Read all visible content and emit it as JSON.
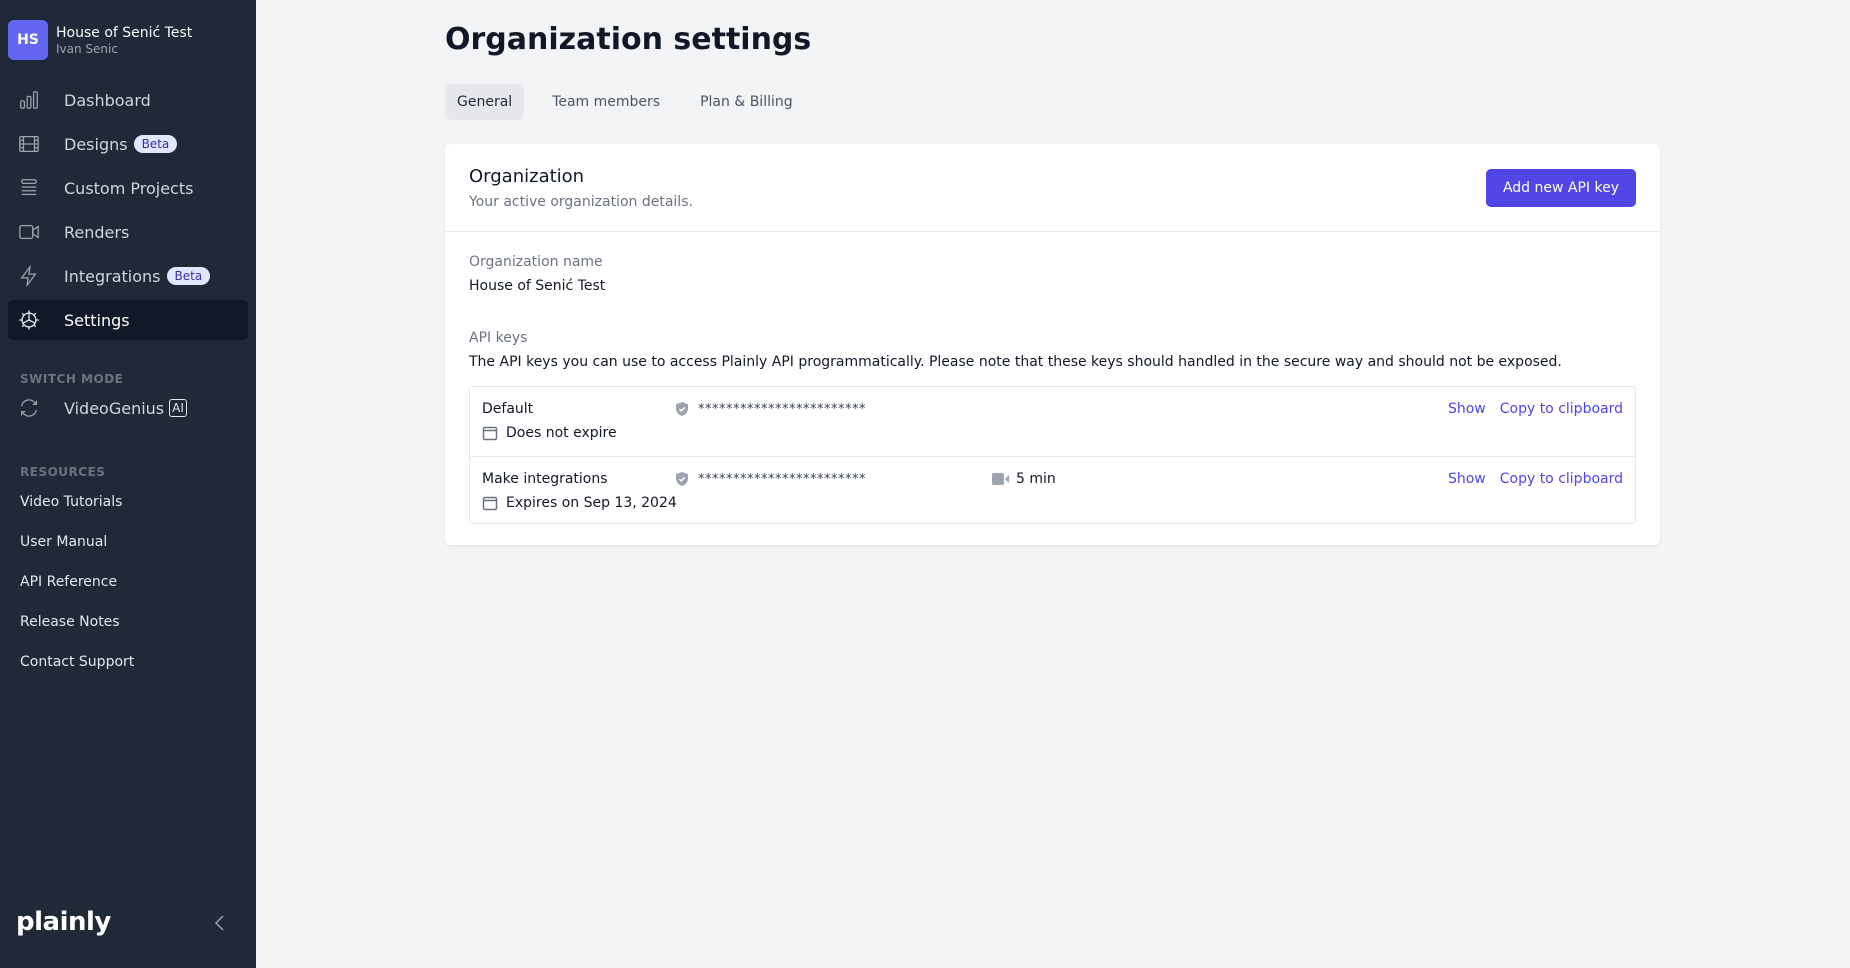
{
  "org": {
    "initials": "HS",
    "name": "House of Senić Test",
    "user": "Ivan Senic"
  },
  "nav": [
    {
      "label": "Dashboard",
      "icon": "bar-chart-icon",
      "badge": null,
      "active": false
    },
    {
      "label": "Designs",
      "icon": "film-icon",
      "badge": "Beta",
      "active": false
    },
    {
      "label": "Custom Projects",
      "icon": "stack-icon",
      "badge": null,
      "active": false
    },
    {
      "label": "Renders",
      "icon": "video-camera-icon",
      "badge": null,
      "active": false
    },
    {
      "label": "Integrations",
      "icon": "bolt-icon",
      "badge": "Beta",
      "active": false
    },
    {
      "label": "Settings",
      "icon": "gear-icon",
      "badge": null,
      "active": true
    }
  ],
  "switch_mode": {
    "title": "SWITCH MODE",
    "label": "VideoGenius",
    "badge": "AI"
  },
  "resources": {
    "title": "RESOURCES",
    "links": [
      "Video Tutorials",
      "User Manual",
      "API Reference",
      "Release Notes",
      "Contact Support"
    ]
  },
  "logo": "plainly",
  "page": {
    "title": "Organization settings",
    "tabs": [
      {
        "label": "General",
        "active": true
      },
      {
        "label": "Team members",
        "active": false
      },
      {
        "label": "Plan & Billing",
        "active": false
      }
    ]
  },
  "card": {
    "title": "Organization",
    "subtitle": "Your active organization details.",
    "add_key_button": "Add new API key",
    "org_name_label": "Organization name",
    "org_name_value": "House of Senić Test",
    "api_keys_label": "API keys",
    "api_keys_description": "The API keys you can use to access Plainly API programmatically. Please note that these keys should handled in the secure way and should not be exposed.",
    "keys": [
      {
        "name": "Default",
        "expiry": "Does not expire",
        "secret": "************************",
        "usage": null,
        "show": "Show",
        "copy": "Copy to clipboard"
      },
      {
        "name": "Make integrations",
        "expiry": "Expires on Sep 13, 2024",
        "secret": "************************",
        "usage": "5 min",
        "show": "Show",
        "copy": "Copy to clipboard"
      }
    ]
  },
  "colors": {
    "sidebar_bg": "#1f2937",
    "accent": "#4f46e5",
    "avatar": "#6366f1",
    "page_bg": "#f3f4f6"
  }
}
